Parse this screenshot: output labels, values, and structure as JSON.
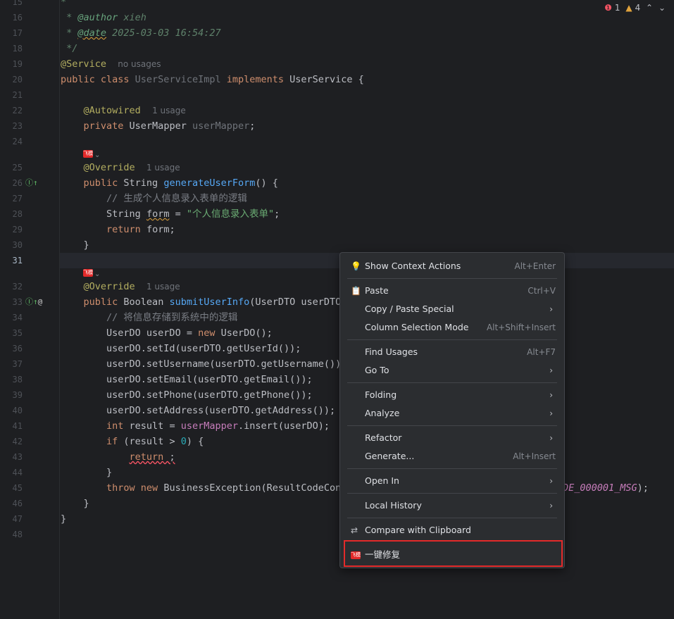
{
  "status": {
    "errors": "1",
    "warnings": "4",
    "up": "⌃",
    "down": "⌄"
  },
  "plugin_badge": "飞模",
  "gutter_icons": {
    "impl": "Ⓘ↑",
    "at": "@"
  },
  "code": {
    "l15": "*",
    "l16a": " * ",
    "l16b": "@author",
    "l16c": " xieh",
    "l17a": " * ",
    "l17b": "@date",
    "l17c": " 2025-03-03 16:54:27",
    "l18": " */",
    "l19a": "@Service",
    "l19hint": "no usages",
    "l20a": "public class ",
    "l20b": "UserServiceImpl",
    "l20c": " implements ",
    "l20d": "UserService",
    "l20e": " {",
    "l22a": "@Autowired",
    "l22hint": "1 usage",
    "l23a": "private ",
    "l23b": "UserMapper ",
    "l23c": "userMapper",
    "l23d": ";",
    "l25a": "@Override",
    "l25hint": "1 usage",
    "l26a": "public ",
    "l26b": "String ",
    "l26c": "generateUserForm",
    "l26d": "() {",
    "l27": "// 生成个人信息录入表单的逻辑",
    "l28a": "String ",
    "l28b": "form",
    "l28c": " = ",
    "l28d": "\"个人信息录入表单\"",
    "l28e": ";",
    "l29a": "return ",
    "l29b": "form;",
    "l30": "}",
    "l32a": "@Override",
    "l32hint": "1 usage",
    "l33a": "public ",
    "l33b": "Boolean ",
    "l33c": "submitUserInfo",
    "l33d": "(UserDTO userDTO)",
    "l34": "// 将信息存储到系统中的逻辑",
    "l35a": "UserDO userDO = ",
    "l35b": "new ",
    "l35c": "UserDO();",
    "l36": "userDO.setId(userDTO.getUserId());",
    "l37": "userDO.setUsername(userDTO.getUsername());",
    "l38": "userDO.setEmail(userDTO.getEmail());",
    "l39": "userDO.setPhone(userDTO.getPhone());",
    "l40": "userDO.setAddress(userDTO.getAddress());",
    "l41a": "int ",
    "l41b": "result = ",
    "l41c": "userMapper",
    "l41d": ".insert(userDO);",
    "l42a": "if ",
    "l42b": "(result > ",
    "l42c": "0",
    "l42d": ") {",
    "l43a": "return",
    "l43b": " ;",
    "l44": "}",
    "l45a": "throw new ",
    "l45b": "BusinessException(ResultCodeCons",
    "l45c": "DE_000001_MSG",
    "l45d": ");",
    "l46": "}",
    "l47": "}"
  },
  "menu": {
    "items": [
      {
        "label": "Show Context Actions",
        "shortcut": "Alt+Enter"
      },
      {
        "label": "Paste",
        "shortcut": "Ctrl+V"
      },
      {
        "label": "Copy / Paste Special",
        "submenu": "›"
      },
      {
        "label": "Column Selection Mode",
        "shortcut": "Alt+Shift+Insert"
      },
      {
        "label": "Find Usages",
        "shortcut": "Alt+F7"
      },
      {
        "label": "Go To",
        "submenu": "›"
      },
      {
        "label": "Folding",
        "submenu": "›"
      },
      {
        "label": "Analyze",
        "submenu": "›"
      },
      {
        "label": "Refactor",
        "submenu": "›"
      },
      {
        "label": "Generate...",
        "shortcut": "Alt+Insert"
      },
      {
        "label": "Open In",
        "submenu": "›"
      },
      {
        "label": "Local History",
        "submenu": "›"
      },
      {
        "label": "Compare with Clipboard"
      },
      {
        "label": "一键修复"
      }
    ]
  },
  "line_numbers": [
    "15",
    "16",
    "17",
    "18",
    "19",
    "20",
    "21",
    "22",
    "23",
    "24",
    "25",
    "26",
    "27",
    "28",
    "29",
    "30",
    "31",
    "32",
    "33",
    "34",
    "35",
    "36",
    "37",
    "38",
    "39",
    "40",
    "41",
    "42",
    "43",
    "44",
    "45",
    "46",
    "47",
    "48"
  ]
}
